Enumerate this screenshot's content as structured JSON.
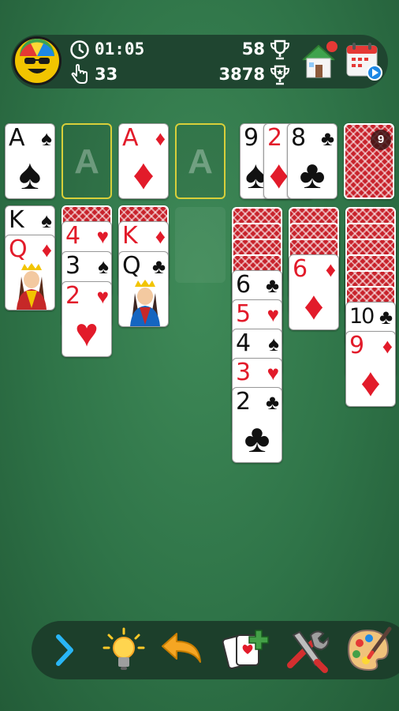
{
  "stats": {
    "timer": "01:05",
    "moves": "33",
    "score_top": "58",
    "score_bottom": "3878"
  },
  "stock": {
    "remaining": "9"
  },
  "foundations": [
    {
      "slot": 1,
      "top_rank": "A",
      "top_suit": "♠",
      "color": "black"
    },
    {
      "slot": 2,
      "placeholder": "A"
    },
    {
      "slot": 3,
      "top_rank": "A",
      "top_suit": "♦",
      "color": "red"
    },
    {
      "slot": 4,
      "placeholder": "A"
    }
  ],
  "waste": [
    {
      "rank": "9",
      "suit": "♠"
    },
    {
      "rank": "2",
      "suit": "♦"
    },
    {
      "rank": "8",
      "suit": "♣"
    }
  ],
  "tableau": [
    {
      "column": 1,
      "face_down": 0,
      "face_up": [
        {
          "rank": "K",
          "suit": "♠"
        },
        {
          "rank": "Q",
          "suit": "♦"
        }
      ]
    },
    {
      "column": 2,
      "face_down": 1,
      "face_up": [
        {
          "rank": "4",
          "suit": "♥"
        },
        {
          "rank": "3",
          "suit": "♠"
        },
        {
          "rank": "2",
          "suit": "♥"
        }
      ]
    },
    {
      "column": 3,
      "face_down": 1,
      "face_up": [
        {
          "rank": "K",
          "suit": "♦"
        },
        {
          "rank": "Q",
          "suit": "♣"
        }
      ]
    },
    {
      "column": 4,
      "face_down": 0,
      "face_up": []
    },
    {
      "column": 5,
      "face_down": 4,
      "face_up": [
        {
          "rank": "6",
          "suit": "♣"
        },
        {
          "rank": "5",
          "suit": "♥"
        },
        {
          "rank": "4",
          "suit": "♠"
        },
        {
          "rank": "3",
          "suit": "♥"
        },
        {
          "rank": "2",
          "suit": "♣"
        }
      ]
    },
    {
      "column": 6,
      "face_down": 3,
      "face_up": [
        {
          "rank": "6",
          "suit": "♦"
        }
      ]
    },
    {
      "column": 7,
      "face_down": 6,
      "face_up": [
        {
          "rank": "10",
          "suit": "♣"
        },
        {
          "rank": "9",
          "suit": "♦"
        }
      ]
    }
  ],
  "colors": {
    "felt": "#2f7448",
    "bar": "#1f4530",
    "red_suit": "#e21b2a",
    "card_back": "#c8232c",
    "foundation_outline": "#d8cf3a"
  },
  "icons": {
    "avatar": "smiley-avatar-icon",
    "timer": "clock-icon",
    "moves": "tap-hand-icon",
    "score_top": "trophy-icon",
    "score_bottom": "trophy-star-icon",
    "home": "home-icon",
    "daily": "calendar-play-icon",
    "toolbar": [
      "chevron-right-icon",
      "lightbulb-icon",
      "undo-arrow-icon",
      "new-game-cards-icon",
      "settings-tools-icon",
      "theme-palette-icon"
    ]
  }
}
